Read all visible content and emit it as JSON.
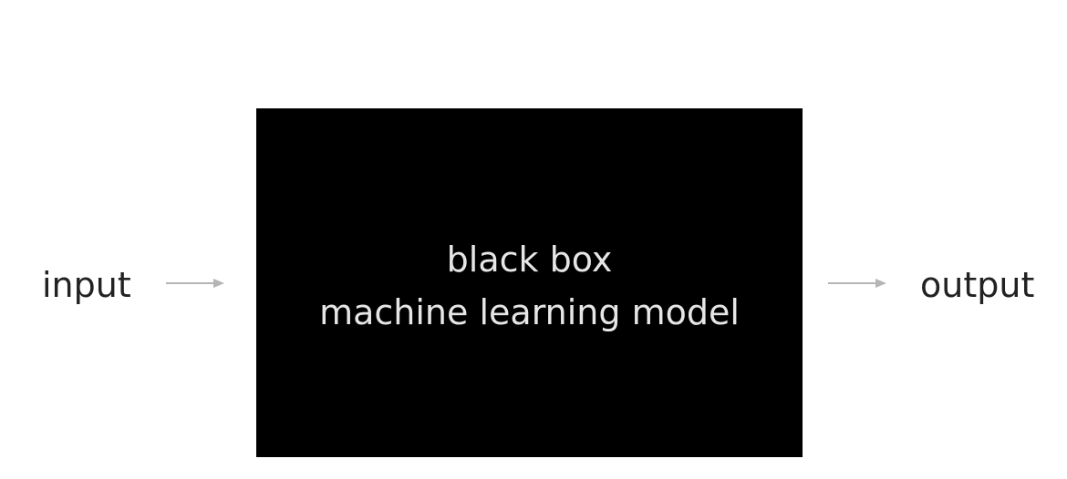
{
  "diagram": {
    "input_label": "input",
    "output_label": "output",
    "model": {
      "line1": "black box",
      "line2": "machine learning model"
    },
    "colors": {
      "box_fill": "#000000",
      "box_text": "#e6e6e6",
      "label_text": "#222222",
      "arrow": "#b5b5b5"
    }
  }
}
